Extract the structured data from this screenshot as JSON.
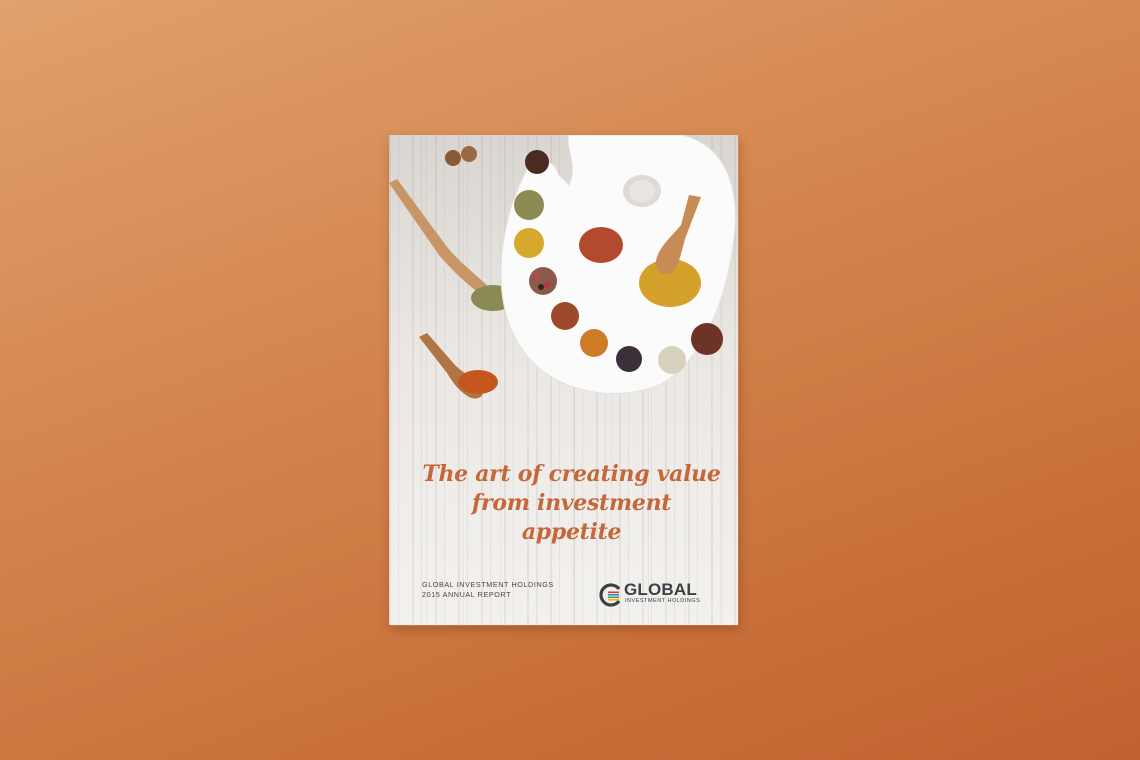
{
  "cover": {
    "tagline_line1": "The art of creating value",
    "tagline_line2": "from investment appetite",
    "company_line": "GLOBAL INVESTMENT HOLDINGS",
    "report_line": "2015 ANNUAL REPORT",
    "logo_word": "GLOBAL",
    "logo_sub": "INVESTMENT HOLDINGS"
  },
  "colors": {
    "background": "#d4864f",
    "tagline": "#c4673a",
    "logo_text": "#3d3f45",
    "logo_stripes": [
      "#e4362b",
      "#2a8ad6",
      "#3aa54a",
      "#f2b21d"
    ]
  },
  "illustration": {
    "subject": "painter-palette-with-spices",
    "items": [
      "star-anise",
      "oregano",
      "turmeric",
      "paprika",
      "peppercorns",
      "cinnamon",
      "curry",
      "juniper",
      "white-pepper",
      "cloves",
      "wooden-scoop",
      "wooden-spoon",
      "nutmeg"
    ]
  }
}
